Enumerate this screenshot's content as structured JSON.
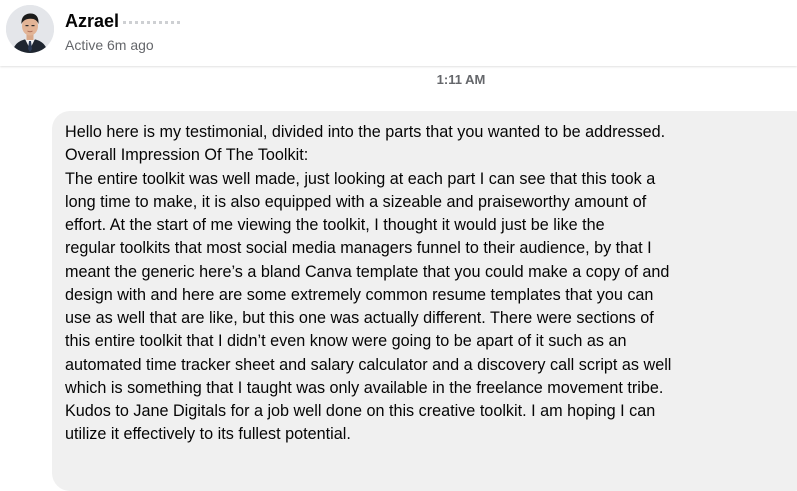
{
  "contact": {
    "name": "Azrael",
    "status": "Active 6m ago"
  },
  "conversation": {
    "timestamp": "1:11 AM",
    "message_lines": [
      "Hello here is my testimonial, divided into the parts that you wanted to be addressed.",
      "Overall Impression Of The Toolkit:",
      "The entire toolkit was well made, just looking at each part I can see that this took a",
      "long time to make, it is also equipped with a sizeable and praiseworthy amount of",
      "effort. At the start of me viewing the toolkit, I thought it would just be like the",
      "regular toolkits that most social media managers funnel to their audience, by that I",
      "meant the generic here’s a bland Canva template that you could make a copy of and",
      "design with and here are some extremely common resume templates that you can",
      "use as well that are like, but this one was actually different. There were sections of",
      "this entire toolkit that I didn’t even know were going to be apart of it such as an",
      "automated time tracker sheet and salary calculator and a discovery call script as well",
      "which is something that I taught was only available in the freelance movement tribe.",
      "Kudos to Jane Digitals for a job well done on this creative toolkit. I am hoping I can",
      "utilize it effectively to its fullest potential."
    ]
  },
  "colors": {
    "bubble_background": "#f0f0f0",
    "secondary_text": "#65676b",
    "primary_text": "#050505"
  }
}
